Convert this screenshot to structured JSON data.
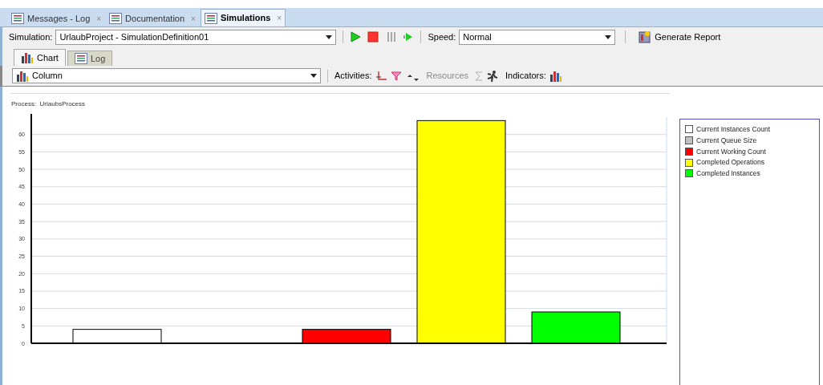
{
  "editor_tabs": [
    {
      "label": "Messages - Log",
      "close": "×",
      "selected": false
    },
    {
      "label": "Documentation",
      "close": "×",
      "selected": false
    },
    {
      "label": "Simulations",
      "close": "×",
      "selected": true
    }
  ],
  "toolbar": {
    "simulation_label": "Simulation:",
    "simulation_value": "UrlaubProject - SimulationDefinition01",
    "speed_label": "Speed:",
    "speed_value": "Normal",
    "report_button": "Generate Report"
  },
  "view_tabs": [
    {
      "label": "Chart",
      "selected": true
    },
    {
      "label": "Log",
      "selected": false
    }
  ],
  "chart_toolbar": {
    "chart_type": "Column",
    "activities_label": "Activities:",
    "resources_label": "Resources",
    "resources_disabled": true,
    "indicators_label": "Indicators:"
  },
  "chart": {
    "process_label": "Process:  UrlaubsProcess",
    "chart_data": {
      "type": "bar",
      "grid": true,
      "ylim": [
        0,
        65
      ],
      "yticks": [
        0,
        5,
        10,
        15,
        20,
        25,
        30,
        35,
        40,
        45,
        50,
        55,
        60
      ],
      "series": [
        {
          "name": "Current Instances Count",
          "color": "#ffffff",
          "values": [
            4
          ]
        },
        {
          "name": "Current Queue Size",
          "color": "#c0c0c0",
          "values": [
            0
          ]
        },
        {
          "name": "Current Working Count",
          "color": "#ff0000",
          "values": [
            4
          ]
        },
        {
          "name": "Completed Operations",
          "color": "#ffff00",
          "values": [
            64
          ]
        },
        {
          "name": "Completed Instances",
          "color": "#00ff00",
          "values": [
            9
          ]
        }
      ]
    }
  }
}
